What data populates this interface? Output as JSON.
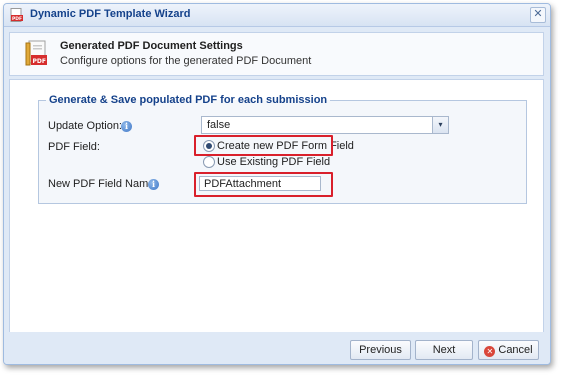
{
  "window": {
    "title": "Dynamic PDF Template Wizard",
    "close_glyph": "✕",
    "icon": "pdf-wizard-icon"
  },
  "header": {
    "icon": "pdf-document-icon",
    "title": "Generated PDF Document Settings",
    "subtitle": "Configure options for the generated PDF Document"
  },
  "group": {
    "legend": "Generate & Save populated PDF for each submission",
    "update_option": {
      "label": "Update Option:",
      "value": "false",
      "info_glyph": "i",
      "arrow_glyph": "▾"
    },
    "pdf_field": {
      "label": "PDF Field:",
      "options": [
        {
          "label": "Create new PDF Form Field",
          "selected": true
        },
        {
          "label": "Use Existing PDF Field",
          "selected": false
        }
      ]
    },
    "new_field_name": {
      "label": "New PDF Field Name:",
      "value": "PDFAttachment",
      "info_glyph": "i"
    }
  },
  "buttons": {
    "previous": "Previous",
    "next": "Next",
    "cancel": "Cancel"
  },
  "colors": {
    "highlight": "#d9202b",
    "title_text": "#15428b",
    "window_bg": "#dfe9f6"
  }
}
